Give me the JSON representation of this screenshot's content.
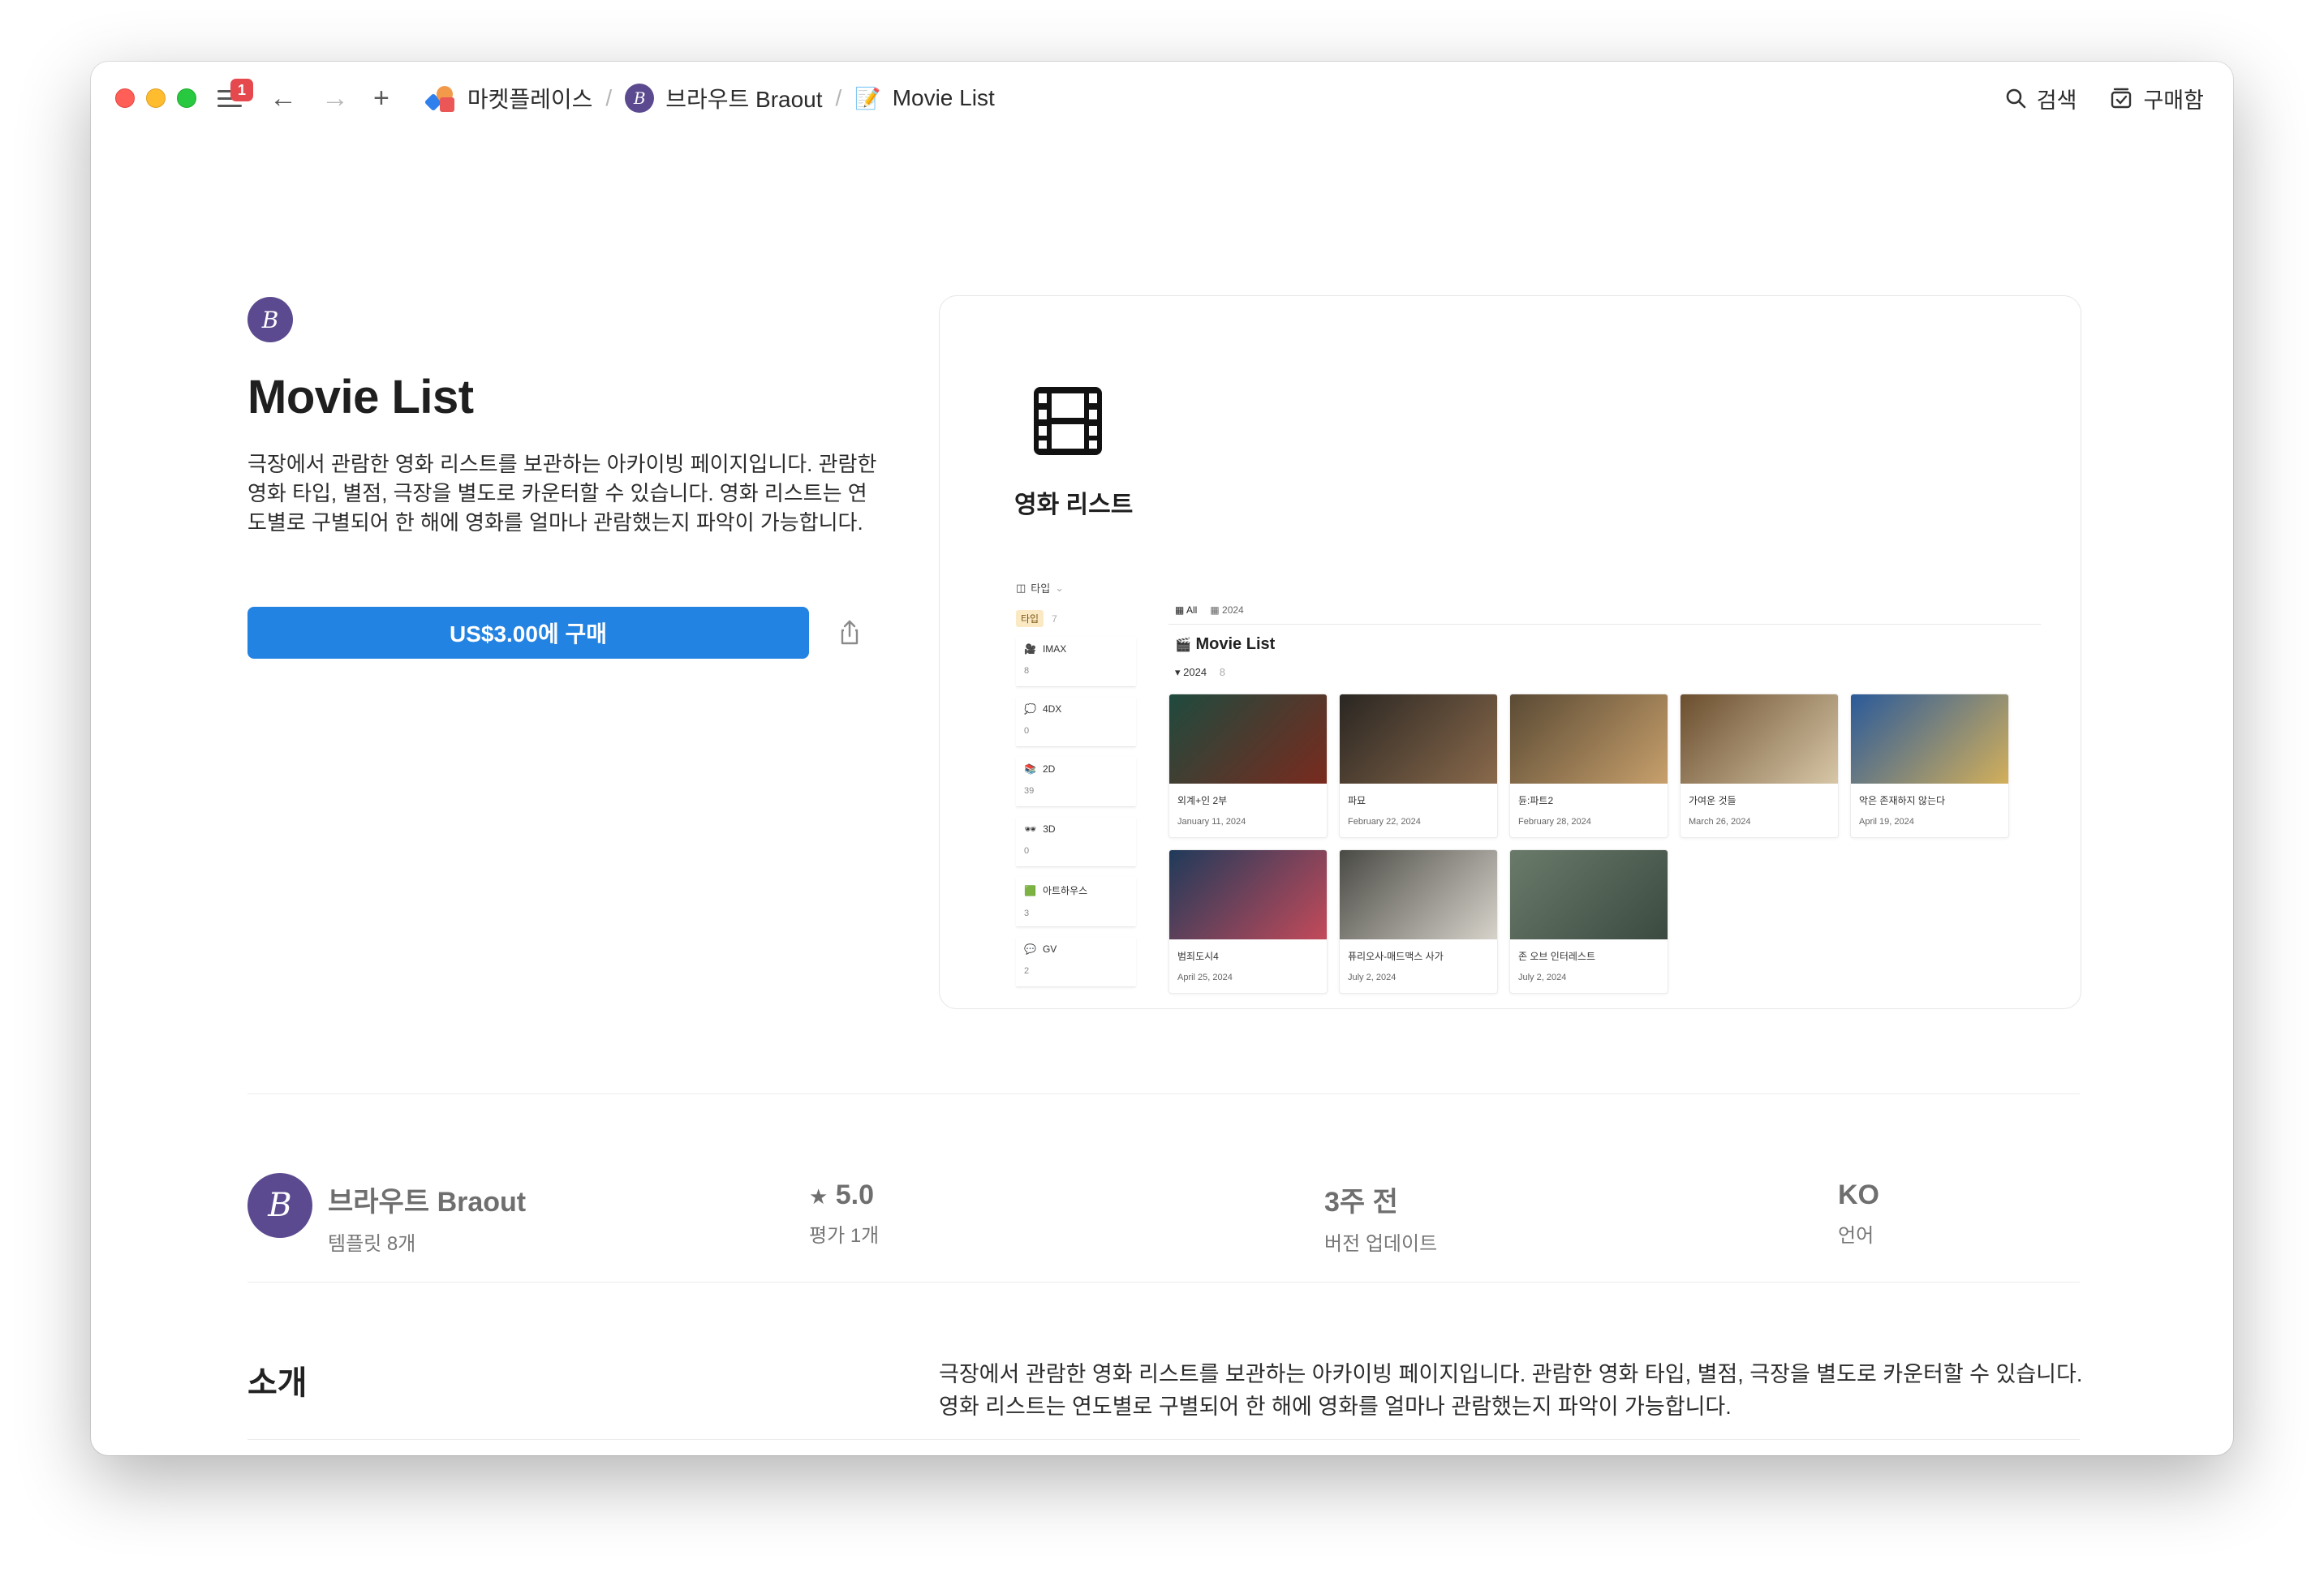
{
  "titlebar": {
    "notification_count": "1",
    "breadcrumbs": [
      {
        "label": "마켓플레이스"
      },
      {
        "label": "브라우트 Braout"
      },
      {
        "label": "Movie List"
      }
    ],
    "avatar_letter": "B",
    "search_label": "검색",
    "purchases_label": "구매함"
  },
  "product": {
    "avatar_letter": "B",
    "title": "Movie List",
    "description": "극장에서 관람한 영화 리스트를 보관하는 아카이빙 페이지입니다. 관람한 영화 타입, 별점, 극장을 별도로 카운터할 수 있습니다. 영화 리스트는 연도별로 구별되어 한 해에 영화를 얼마나 관람했는지 파악이 가능합니다.",
    "buy_label": "US$3.00에 구매"
  },
  "preview": {
    "page_title": "영화 리스트",
    "sidebar": {
      "header": "타입",
      "chip": "타입",
      "chip_count": "7",
      "items": [
        {
          "name": "IMAX",
          "count": "8",
          "icon": "🎥"
        },
        {
          "name": "4DX",
          "count": "0",
          "icon": "💭"
        },
        {
          "name": "2D",
          "count": "39",
          "icon": "📚"
        },
        {
          "name": "3D",
          "count": "0",
          "icon": "🕶"
        },
        {
          "name": "아트하우스",
          "count": "3",
          "icon": "🟩"
        },
        {
          "name": "GV",
          "count": "2",
          "icon": "💬"
        }
      ]
    },
    "tabs": [
      {
        "label": "All"
      },
      {
        "label": "2024"
      }
    ],
    "db_title": "Movie List",
    "group_label": "2024",
    "group_count": "8",
    "cards": [
      {
        "name": "외계+인 2부",
        "date": "January 11, 2024",
        "c1": "#1f4a3e",
        "c2": "#7a2a1e"
      },
      {
        "name": "파묘",
        "date": "February 22, 2024",
        "c1": "#2a2622",
        "c2": "#8a6a4c"
      },
      {
        "name": "듄:파트2",
        "date": "February 28, 2024",
        "c1": "#5a4a34",
        "c2": "#c8a06c"
      },
      {
        "name": "가여운 것들",
        "date": "March 26, 2024",
        "c1": "#6b4e2e",
        "c2": "#d8c8a8"
      },
      {
        "name": "악은 존재하지 않는다",
        "date": "April 19, 2024",
        "c1": "#2a5a9a",
        "c2": "#d4b05a"
      },
      {
        "name": "범죄도시4",
        "date": "April 25, 2024",
        "c1": "#1f3a5a",
        "c2": "#c44a5a"
      },
      {
        "name": "퓨리오사-매드맥스 사가",
        "date": "July 2, 2024",
        "c1": "#4a4a44",
        "c2": "#d8d4cc"
      },
      {
        "name": "존 오브 인터레스트",
        "date": "July 2, 2024",
        "c1": "#6a7a6a",
        "c2": "#3a4a40"
      }
    ]
  },
  "stats": {
    "creator_letter": "B",
    "creator_name": "브라우트 Braout",
    "creator_sub": "템플릿 8개",
    "rating_value": "5.0",
    "rating_label": "평가 1개",
    "updated_value": "3주 전",
    "updated_label": "버전 업데이트",
    "language_value": "KO",
    "language_label": "언어"
  },
  "intro": {
    "heading": "소개",
    "text": "극장에서 관람한 영화 리스트를 보관하는 아카이빙 페이지입니다. 관람한 영화 타입, 별점, 극장을 별도로 카운터할 수 있습니다. 영화 리스트는 연도별로 구별되어 한 해에 영화를 얼마나 관람했는지 파악이 가능합니다."
  },
  "colors": {
    "accent": "#2383e2",
    "creator_avatar": "#5b4a8f"
  }
}
